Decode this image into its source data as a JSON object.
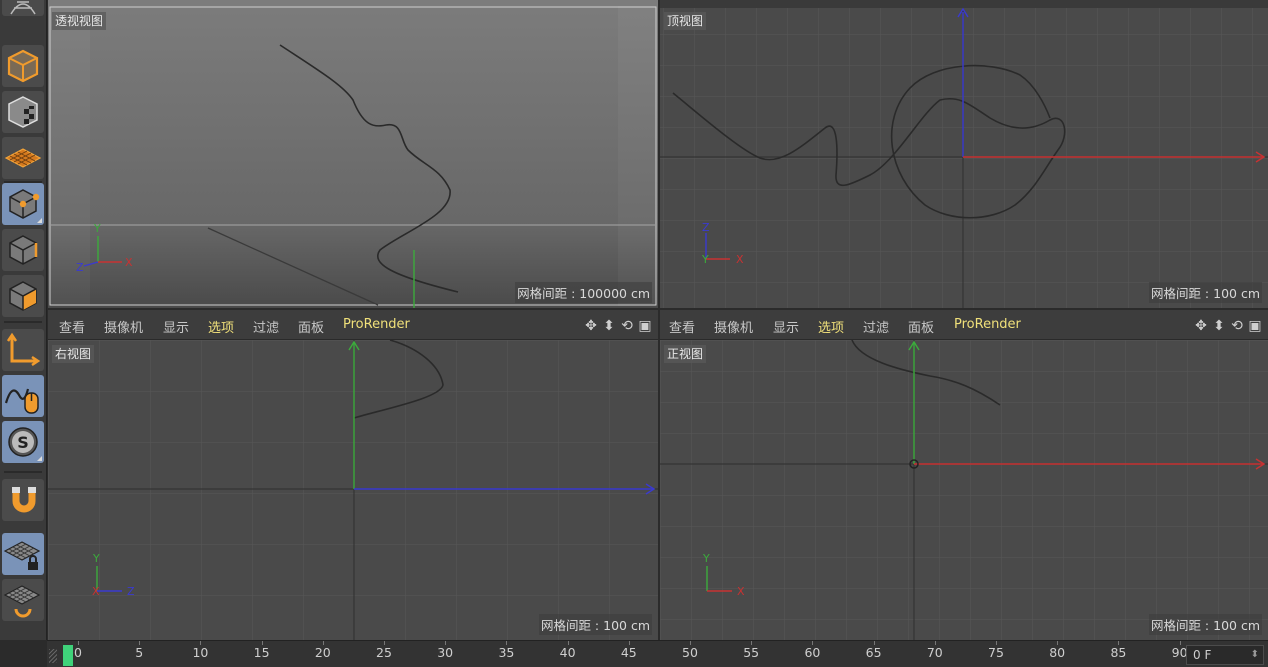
{
  "viewports": {
    "perspective": {
      "label": "透视视图",
      "grid_spacing": "网格间距 : 100000 cm"
    },
    "top": {
      "label": "顶视图",
      "grid_spacing": "网格间距 : 100 cm"
    },
    "right": {
      "label": "右视图",
      "grid_spacing": "网格间距 : 100 cm"
    },
    "front": {
      "label": "正视图",
      "grid_spacing": "网格间距 : 100 cm"
    }
  },
  "viewport_menu": {
    "view": "查看",
    "camera": "摄像机",
    "display": "显示",
    "options": "选项",
    "filter": "过滤",
    "panel": "面板",
    "prorender": "ProRender"
  },
  "axes": {
    "x": "X",
    "y": "Y",
    "z": "Z"
  },
  "timeline": {
    "ticks": [
      "0",
      "5",
      "10",
      "15",
      "20",
      "25",
      "30",
      "35",
      "40",
      "45",
      "50",
      "55",
      "60",
      "65",
      "70",
      "75",
      "80",
      "85",
      "90"
    ],
    "current_frame": "0 F"
  },
  "colors": {
    "axis_x": "#c83232",
    "axis_y": "#3cab3c",
    "axis_z": "#3a3ad0",
    "highlight_menu": "#f0e07a",
    "active_tool": "#7a93b8",
    "playhead": "#3fd27a"
  },
  "tools": [
    {
      "icon": "model-mode-icon"
    },
    {
      "icon": "texture-mode-icon"
    },
    {
      "icon": "workplane-mode-icon"
    },
    {
      "icon": "points-mode-icon"
    },
    {
      "icon": "edges-mode-icon"
    },
    {
      "icon": "polygons-mode-icon"
    },
    {
      "icon": "axis-mode-icon"
    },
    {
      "icon": "tweak-mode-icon"
    },
    {
      "icon": "solo-mode-icon"
    },
    {
      "icon": "snap-icon"
    },
    {
      "icon": "workplane-lock-icon"
    },
    {
      "icon": "workplane-align-icon"
    }
  ]
}
